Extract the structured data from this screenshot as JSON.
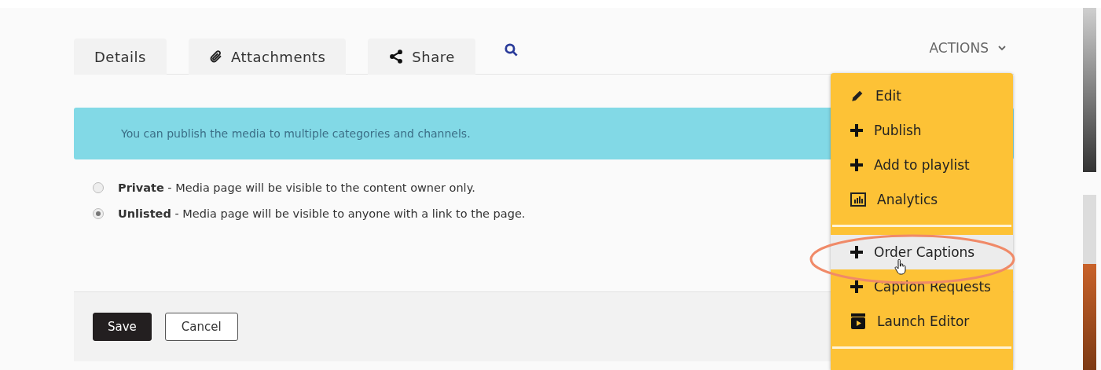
{
  "tabs": [
    {
      "label": "Details",
      "selected": false
    },
    {
      "label": "Attachments",
      "selected": false
    },
    {
      "label": "Share",
      "selected": false
    }
  ],
  "actions": {
    "label": "ACTIONS",
    "expanded": true,
    "groups": [
      [
        {
          "label": "Edit",
          "hovered": false,
          "circled": false
        },
        {
          "label": "Publish",
          "hovered": false,
          "circled": false
        },
        {
          "label": "Add to playlist",
          "hovered": false,
          "circled": false
        },
        {
          "label": "Analytics",
          "hovered": false,
          "circled": false
        }
      ],
      [
        {
          "label": "Order Captions",
          "hovered": true,
          "circled": true
        },
        {
          "label": "Caption Requests",
          "hovered": false,
          "circled": false
        },
        {
          "label": "Launch Editor",
          "hovered": false,
          "circled": false
        }
      ]
    ]
  },
  "banner": "You can publish the media to multiple categories and channels.",
  "options": [
    {
      "text": "**Private** - Media page will be visible to the content owner only.",
      "selected": false
    },
    {
      "text": "**Unlisted** - Media page will be visible to anyone with a link to the page.",
      "selected": true
    }
  ],
  "buttons": [
    {
      "label": "Save",
      "kind": "primary"
    },
    {
      "label": "Cancel",
      "kind": "secondary"
    }
  ]
}
